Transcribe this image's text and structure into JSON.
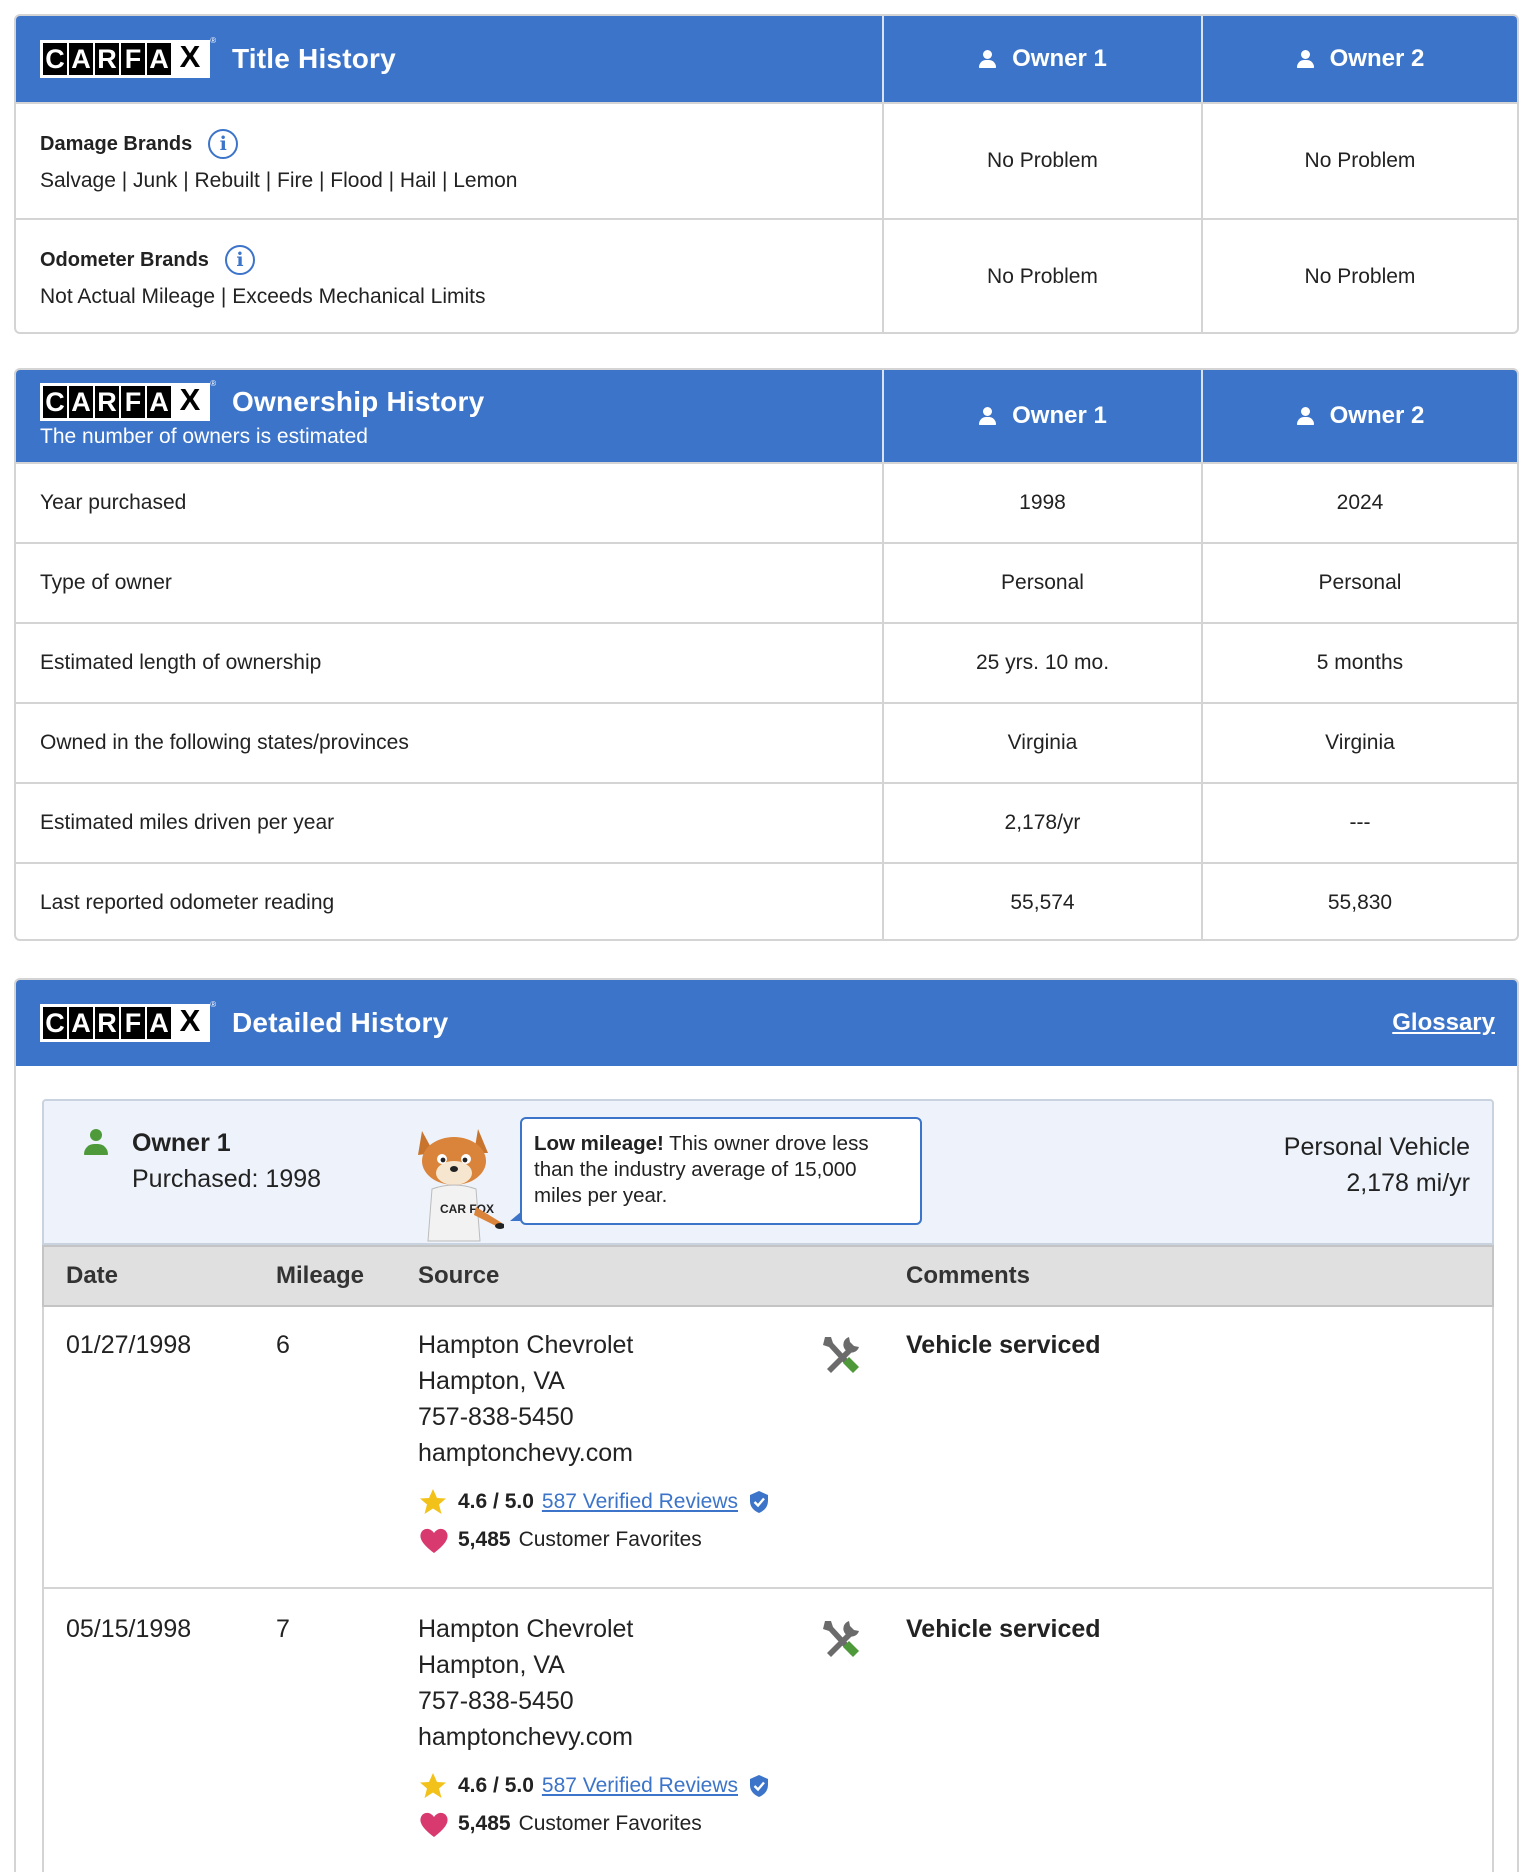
{
  "brand_logo": {
    "letters": [
      "C",
      "A",
      "R",
      "F",
      "A",
      "X"
    ],
    "registered": "®"
  },
  "colors": {
    "header_blue": "#3c74c9",
    "owner_green": "#4e9a3a",
    "star_yellow": "#f2c21b",
    "heart_pink": "#d83a6f"
  },
  "title_history": {
    "title": "Title History",
    "owner_columns": [
      "Owner 1",
      "Owner 2"
    ],
    "rows": [
      {
        "label": "Damage Brands",
        "description": "Salvage | Junk | Rebuilt | Fire | Flood | Hail | Lemon",
        "values": [
          "No Problem",
          "No Problem"
        ],
        "icon": "info-icon"
      },
      {
        "label": "Odometer Brands",
        "description": "Not Actual Mileage | Exceeds Mechanical Limits",
        "values": [
          "No Problem",
          "No Problem"
        ],
        "icon": "info-icon"
      }
    ]
  },
  "ownership_history": {
    "title": "Ownership History",
    "subtitle": "The number of owners is estimated",
    "owner_columns": [
      "Owner 1",
      "Owner 2"
    ],
    "rows": [
      {
        "label": "Year purchased",
        "values": [
          "1998",
          "2024"
        ]
      },
      {
        "label": "Type of owner",
        "values": [
          "Personal",
          "Personal"
        ]
      },
      {
        "label": "Estimated length of ownership",
        "values": [
          "25 yrs. 10 mo.",
          "5 months"
        ]
      },
      {
        "label": "Owned in the following states/provinces",
        "values": [
          "Virginia",
          "Virginia"
        ]
      },
      {
        "label": "Estimated miles driven per year",
        "values": [
          "2,178/yr",
          "---"
        ]
      },
      {
        "label": "Last reported odometer reading",
        "values": [
          "55,574",
          "55,830"
        ]
      }
    ]
  },
  "detailed_history": {
    "title": "Detailed History",
    "glossary_link": "Glossary",
    "owner": {
      "name": "Owner 1",
      "purchased": "Purchased: 1998",
      "bubble_bold": "Low mileage!",
      "bubble_text": " This owner drove less than the industry average of 15,000 miles per year.",
      "vehicle_type": "Personal Vehicle",
      "miles_per_year": "2,178 mi/yr",
      "mascot_shirt": "CAR FOX"
    },
    "columns": [
      "Date",
      "Mileage",
      "Source",
      "Comments"
    ],
    "records": [
      {
        "date": "01/27/1998",
        "mileage": "6",
        "source_name": "Hampton Chevrolet",
        "source_city": "Hampton, VA",
        "source_phone": "757-838-5450",
        "source_web": "hamptonchevy.com",
        "rating": "4.6 / 5.0",
        "reviews_link": "587 Verified Reviews",
        "favorites_count": "5,485",
        "favorites_label": "Customer Favorites",
        "comment": "Vehicle serviced",
        "icon": "service-tools-icon"
      },
      {
        "date": "05/15/1998",
        "mileage": "7",
        "source_name": "Hampton Chevrolet",
        "source_city": "Hampton, VA",
        "source_phone": "757-838-5450",
        "source_web": "hamptonchevy.com",
        "rating": "4.6 / 5.0",
        "reviews_link": "587 Verified Reviews",
        "favorites_count": "5,485",
        "favorites_label": "Customer Favorites",
        "comment": "Vehicle serviced",
        "icon": "service-tools-icon"
      }
    ]
  }
}
